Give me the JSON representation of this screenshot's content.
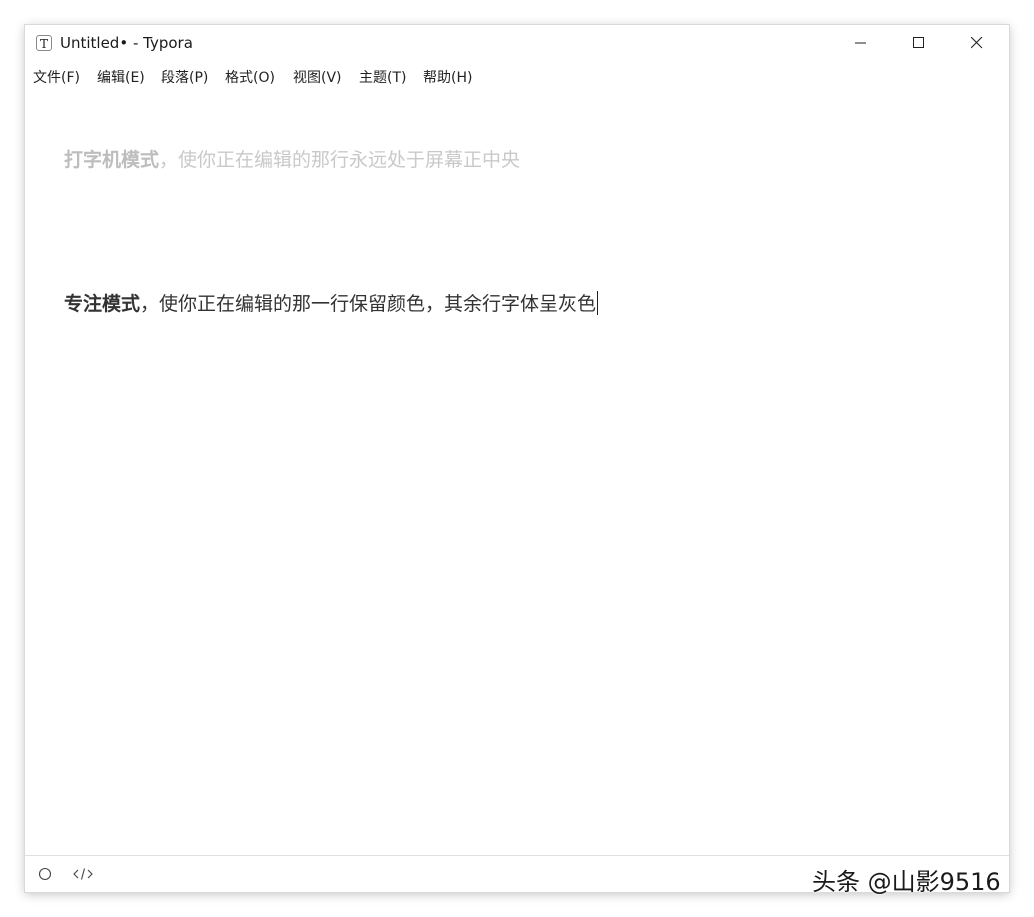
{
  "window": {
    "title": "Untitled• - Typora",
    "app_icon_glyph": "T"
  },
  "window_controls": {
    "minimize_icon": "minimize-icon",
    "maximize_icon": "maximize-icon",
    "close_icon": "close-icon"
  },
  "menubar": {
    "items": [
      {
        "label": "文件(F)"
      },
      {
        "label": "编辑(E)"
      },
      {
        "label": "段落(P)"
      },
      {
        "label": "格式(O)"
      },
      {
        "label": "视图(V)"
      },
      {
        "label": "主题(T)"
      },
      {
        "label": "帮助(H)"
      }
    ]
  },
  "editor": {
    "paragraphs": [
      {
        "bold": "打字机模式",
        "rest": "，使你正在编辑的那行永远处于屏幕正中央",
        "state": "dimmed"
      },
      {
        "bold": "专注模式",
        "rest": "，使你正在编辑的那一行保留颜色，其余行字体呈灰色",
        "state": "focused"
      }
    ]
  },
  "statusbar": {
    "left_icons": [
      "circle-icon",
      "source-code-icon"
    ]
  },
  "watermark": {
    "text": "头条 @山影9516"
  },
  "colors": {
    "text_focused": "#333333",
    "text_dimmed": "#c9c9c9",
    "background": "#ffffff"
  }
}
